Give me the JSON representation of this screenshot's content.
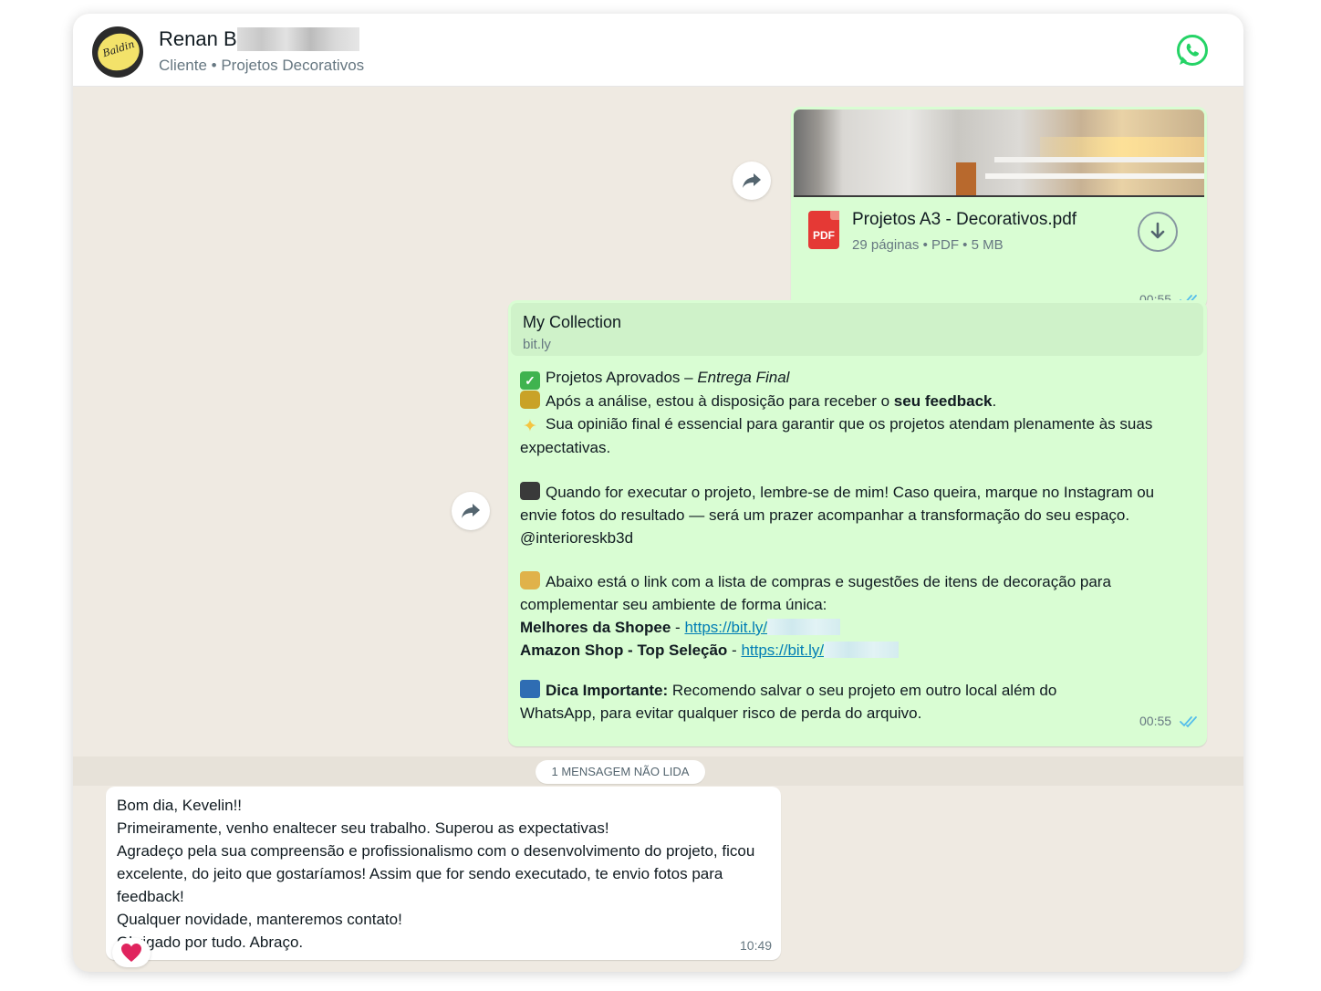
{
  "header": {
    "contact_name": "Renan B",
    "contact_subtitle": "Cliente • Projetos Decorativos",
    "avatar_text": "Baldin",
    "app_icon": "whatsapp-icon",
    "app_color": "#25d366"
  },
  "messages": {
    "file": {
      "file_name": "Projetos A3 - Decorativos.pdf",
      "file_meta": "29 páginas • PDF • 5 MB",
      "file_type_label": "PDF",
      "time": "00:55",
      "status": "read"
    },
    "link": {
      "preview_title": "My Collection",
      "preview_domain": "bit.ly",
      "line1_a": "Projetos Aprovados – ",
      "line1_b": "Entrega Final",
      "line2_a": "Após a análise, estou à disposição para receber o ",
      "line2_b": "seu feedback",
      "line2_c": ".",
      "line3": "Sua opinião final é essencial para garantir que os projetos atendam plenamente às suas expectativas.",
      "para2": "Quando for executar o projeto, lembre-se de mim! Caso queira, marque no Instagram ou envie fotos do resultado — será um prazer acompanhar a transformação do seu espaço.",
      "handle": "@interioreskb3d",
      "para3": "Abaixo está o link com a lista de compras e sugestões de itens de decoração para complementar seu ambiente de forma única:",
      "shopee_label": "Melhores da Shopee",
      "shopee_link": "https://bit.ly/",
      "amazon_label": "Amazon Shop - Top Seleção",
      "amazon_link": "https://bit.ly/",
      "separator": " - ",
      "tip_label": "Dica Importante:",
      "tip_text": " Recomendo salvar o seu projeto em outro local além do WhatsApp, para evitar qualquer risco de perda do arquivo.",
      "time": "00:55",
      "status": "read"
    },
    "unread_label": "1 MENSAGEM NÃO LIDA",
    "incoming": {
      "text": "Bom dia, Kevelin!!\nPrimeiramente, venho enaltecer seu trabalho. Superou as expectativas!\nAgradeço pela sua compreensão e profissionalismo com o desenvolvimento do projeto, ficou excelente, do jeito que gostaríamos! Assim que for sendo executado, te envio fotos para feedback!\nQualquer novidade, manteremos contato!\nObrigado por tudo. Abraço.",
      "time": "10:49",
      "reaction": "heart-icon",
      "reaction_color": "#e0245e"
    }
  },
  "colors": {
    "outgoing_bubble": "#d9fdd3",
    "chat_background": "#efeae2",
    "tick_read": "#53bdeb",
    "link": "#027eb5",
    "pdf_red": "#e53935"
  }
}
